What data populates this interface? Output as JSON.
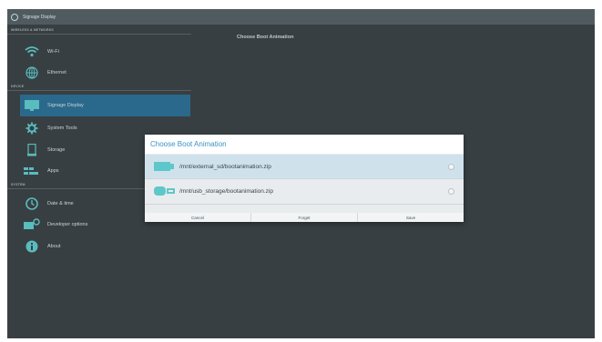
{
  "window": {
    "title": "Signage Display"
  },
  "sidebar": {
    "sections": [
      {
        "label": "WIRELESS & NETWORKS"
      },
      {
        "label": "DEVICE"
      },
      {
        "label": "SYSTEM"
      }
    ],
    "items": [
      {
        "label": "Wi-Fi",
        "icon": "wifi-icon"
      },
      {
        "label": "Ethernet",
        "icon": "ethernet-icon"
      },
      {
        "label": "Signage Display",
        "icon": "display-icon",
        "selected": true
      },
      {
        "label": "System Tools",
        "icon": "gear-icon"
      },
      {
        "label": "Storage",
        "icon": "storage-icon"
      },
      {
        "label": "Apps",
        "icon": "apps-icon"
      },
      {
        "label": "Date & time",
        "icon": "clock-icon"
      },
      {
        "label": "Developer options",
        "icon": "developer-icon"
      },
      {
        "label": "About",
        "icon": "info-icon"
      }
    ]
  },
  "detail": {
    "title": "Choose Boot Animation"
  },
  "dialog": {
    "title": "Choose Boot Animation",
    "options": [
      {
        "label": "/mnt/external_sd/bootanimation.zip",
        "icon": "sd-card-icon",
        "selected": true
      },
      {
        "label": "/mnt/usb_storage/bootanimation.zip",
        "icon": "usb-icon",
        "selected": false
      }
    ],
    "buttons": {
      "cancel": "Cancel",
      "forget": "Forget",
      "save": "Save"
    }
  },
  "colors": {
    "accent": "#2d6f94",
    "dialog_title": "#3b92c6",
    "icon_teal": "#5ec7c9"
  }
}
